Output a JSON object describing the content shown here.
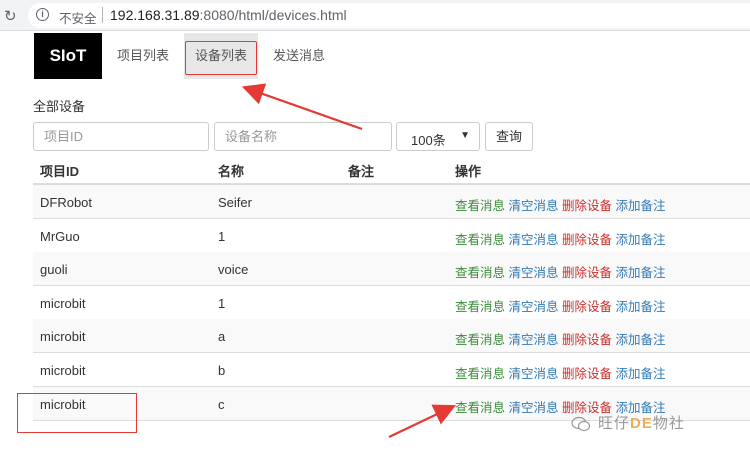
{
  "browser": {
    "security_label": "不安全",
    "url_host": "192.168.31.89",
    "url_rest": ":8080/html/devices.html"
  },
  "navbar": {
    "brand": "SIoT",
    "items": [
      {
        "label": "项目列表",
        "active": false
      },
      {
        "label": "设备列表",
        "active": true
      },
      {
        "label": "发送消息",
        "active": false
      }
    ]
  },
  "section_title": "全部设备",
  "filters": {
    "project_id_placeholder": "项目ID",
    "device_name_placeholder": "设备名称",
    "page_size": "100条",
    "query_label": "查询"
  },
  "table": {
    "headers": [
      "项目ID",
      "名称",
      "备注",
      "操作"
    ],
    "actions": {
      "view": "查看消息",
      "clear": "清空消息",
      "delete": "删除设备",
      "note": "添加备注"
    },
    "rows": [
      {
        "project": "DFRobot",
        "name": "Seifer",
        "note": ""
      },
      {
        "project": "MrGuo",
        "name": "1",
        "note": ""
      },
      {
        "project": "guoli",
        "name": "voice",
        "note": ""
      },
      {
        "project": "microbit",
        "name": "1",
        "note": ""
      },
      {
        "project": "microbit",
        "name": "a",
        "note": ""
      },
      {
        "project": "microbit",
        "name": "b",
        "note": ""
      },
      {
        "project": "microbit",
        "name": "c",
        "note": ""
      }
    ]
  },
  "colors": {
    "accent_red": "#e53935",
    "link_green": "#3c8c3c",
    "link_blue": "#337ab7",
    "link_red": "#c9302c"
  },
  "watermark": {
    "text_prefix": "旺仔",
    "text_logo": "DE",
    "text_suffix": "物社"
  }
}
